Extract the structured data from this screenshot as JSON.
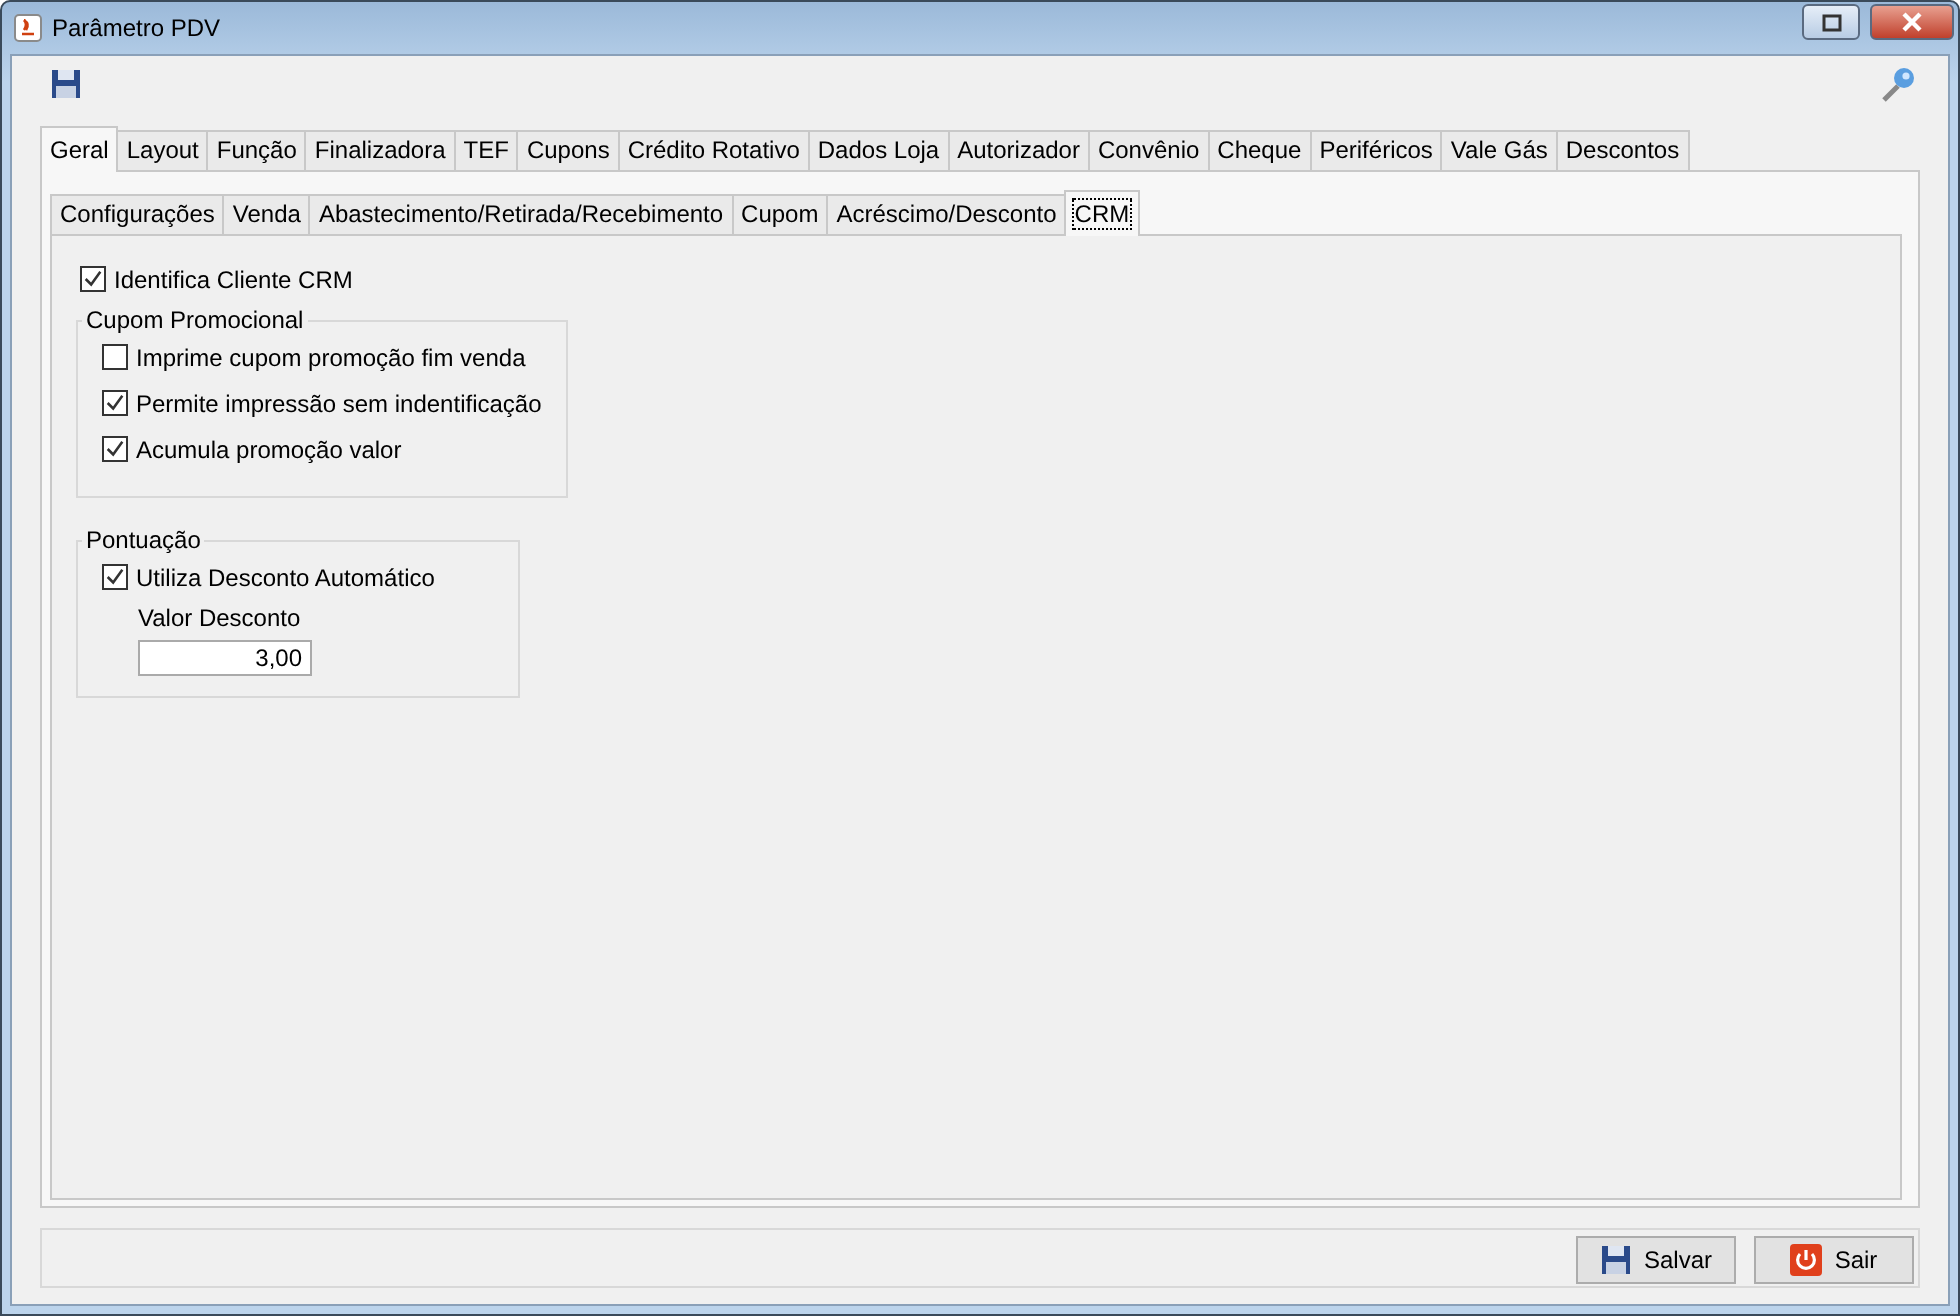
{
  "window": {
    "title": "Parâmetro PDV"
  },
  "tabs": [
    {
      "label": "Geral",
      "selected": true
    },
    {
      "label": "Layout",
      "selected": false
    },
    {
      "label": "Função",
      "selected": false
    },
    {
      "label": "Finalizadora",
      "selected": false
    },
    {
      "label": "TEF",
      "selected": false
    },
    {
      "label": "Cupons",
      "selected": false
    },
    {
      "label": "Crédito Rotativo",
      "selected": false
    },
    {
      "label": "Dados Loja",
      "selected": false
    },
    {
      "label": "Autorizador",
      "selected": false
    },
    {
      "label": "Convênio",
      "selected": false
    },
    {
      "label": "Cheque",
      "selected": false
    },
    {
      "label": "Periféricos",
      "selected": false
    },
    {
      "label": "Vale Gás",
      "selected": false
    },
    {
      "label": "Descontos",
      "selected": false
    }
  ],
  "subtabs": [
    {
      "label": "Configurações",
      "selected": false
    },
    {
      "label": "Venda",
      "selected": false
    },
    {
      "label": "Abastecimento/Retirada/Recebimento",
      "selected": false
    },
    {
      "label": "Cupom",
      "selected": false
    },
    {
      "label": "Acréscimo/Desconto",
      "selected": false
    },
    {
      "label": "CRM",
      "selected": true
    }
  ],
  "identifica": {
    "label": "Identifica Cliente CRM",
    "checked": true
  },
  "cupom_promocional": {
    "title": "Cupom Promocional",
    "options": [
      {
        "label": "Imprime cupom promoção fim venda",
        "checked": false
      },
      {
        "label": "Permite impressão sem indentificação",
        "checked": true
      },
      {
        "label": "Acumula promoção valor",
        "checked": true
      }
    ]
  },
  "pontuacao": {
    "title": "Pontuação",
    "option": {
      "label": "Utiliza Desconto Automático",
      "checked": true
    },
    "field": {
      "label": "Valor Desconto",
      "value": "3,00"
    }
  },
  "buttons": [
    {
      "kind": "save",
      "label": "Salvar"
    },
    {
      "kind": "exit",
      "label": "Sair"
    }
  ]
}
